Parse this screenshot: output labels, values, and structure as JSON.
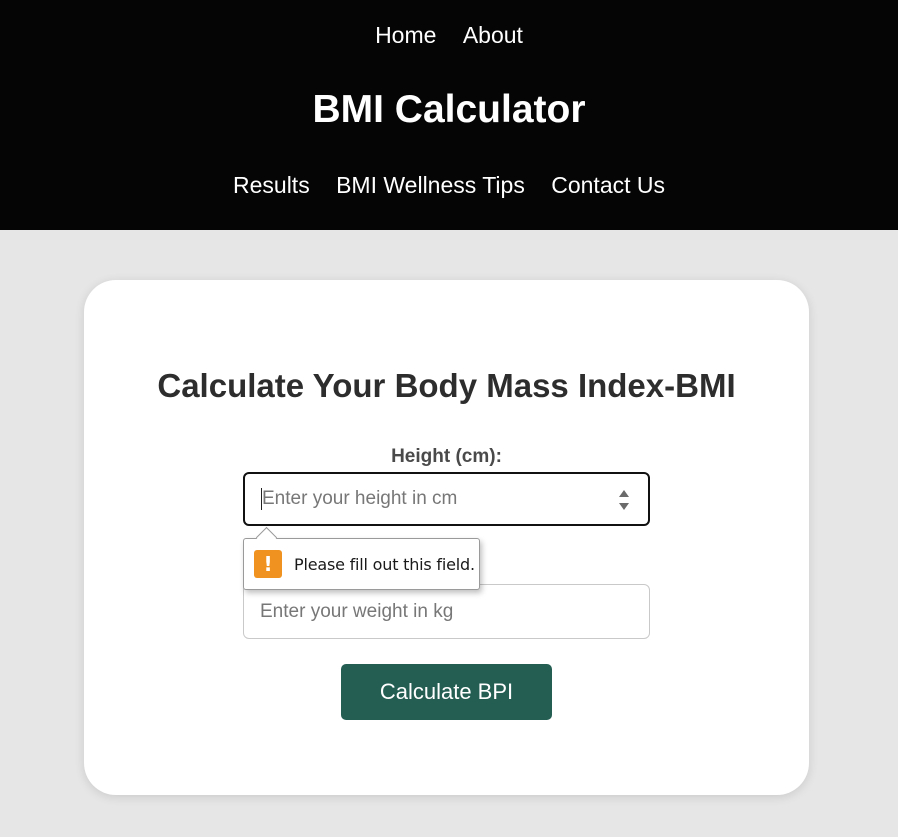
{
  "nav": {
    "top": [
      {
        "label": "Home"
      },
      {
        "label": "About"
      }
    ],
    "sub": [
      {
        "label": "Results"
      },
      {
        "label": "BMI Wellness Tips"
      },
      {
        "label": "Contact Us"
      }
    ]
  },
  "header": {
    "title": "BMI Calculator"
  },
  "form": {
    "heading": "Calculate Your Body Mass Index-BMI",
    "height_label": "Height (cm):",
    "height_placeholder": "Enter your height in cm",
    "weight_placeholder": "Enter your weight in kg",
    "submit_label": "Calculate BPI"
  },
  "validation": {
    "message": "Please fill out this field.",
    "icon": "warning-icon"
  },
  "colors": {
    "header_bg": "#050505",
    "page_bg": "#e6e6e6",
    "button_bg": "#245e53",
    "warning": "#f0921f"
  }
}
